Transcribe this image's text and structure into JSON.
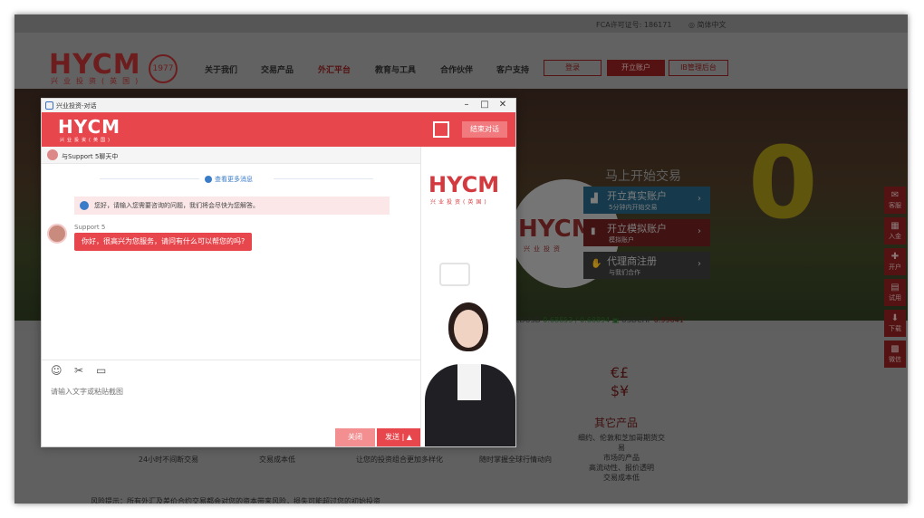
{
  "site": {
    "fca": "FCA许可证号: 186171",
    "lang": "简体中文",
    "logo": "HYCM",
    "logo_sub": "兴业投资(英国)",
    "seal": "1977",
    "nav": [
      "关于我们",
      "交易产品",
      "外汇平台",
      "教育与工具",
      "合作伙伴",
      "客户支持"
    ],
    "buttons": {
      "login": "登录",
      "open": "开立账户",
      "portal": "IB管理后台"
    }
  },
  "hero": {
    "big_text": "0",
    "ball_logo": "HYCM",
    "ball_sub": "兴业投资",
    "trade_title": "马上开始交易",
    "items": [
      {
        "main": "开立真实账户",
        "sub": "5分钟内开始交易"
      },
      {
        "main": "开立模拟账户",
        "sub": "模拟账户"
      },
      {
        "main": "代理商注册",
        "sub": "与我们合作"
      }
    ]
  },
  "float_bar": [
    "客服",
    "入金",
    "开户",
    "试用",
    "下载",
    "微信"
  ],
  "ticker": {
    "label1": "ZDUSD",
    "v1": "0.68853 / 0.68894",
    "label2": "USDCHF",
    "v2": "0.99641"
  },
  "products": {
    "other_title": "其它产品",
    "other_desc": [
      "细约、伦敦和芝加哥期货交易",
      "市场的产品",
      "高流动性、报价透明",
      "交易成本低"
    ],
    "col1": [
      "24小时不间断交易"
    ],
    "col2": [
      "交易成本低"
    ],
    "col3": [
      "让您的投资组合更加多样化"
    ],
    "col4": [
      "随时掌握全球行情动向"
    ],
    "risk": "风险提示：所有外汇及差价合约交易都会对您的资本带来风险，损失可能超过您的初始投资"
  },
  "chat": {
    "window_title": "兴业投资-对话",
    "logo": "HYCM",
    "logo_sub": "兴业投资(英国)",
    "end_label": "结束对话",
    "with_label": "与Support 5聊天中",
    "more_label": "查看更多消息",
    "notice": "您好，请输入您需要咨询的问题，我们将会尽快为您解答。",
    "agent_name": "Support 5",
    "agent_msg": "你好，很高兴为您服务，请问有什么可以帮您的吗?",
    "input_placeholder": "请输入文字或粘贴截图",
    "close_label": "关闭",
    "send_label": "发送 | ▲",
    "side_logo": "HYCM",
    "side_sub": "兴业投资(英国)"
  }
}
